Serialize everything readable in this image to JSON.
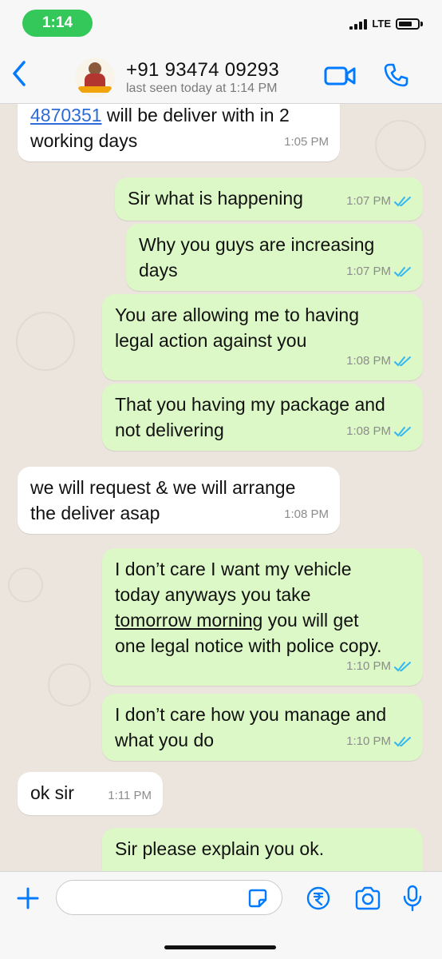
{
  "status_bar": {
    "time": "1:14",
    "network": "LTE"
  },
  "header": {
    "contact_name": "+91 93474 09293",
    "contact_status": "last seen today at 1:14 PM"
  },
  "messages": [
    {
      "direction": "incoming",
      "link": "4870351",
      "text": " will be deliver with in 2\nworking days",
      "time": "1:05 PM"
    },
    {
      "direction": "outgoing",
      "text": "Sir what is happening",
      "time": "1:07 PM"
    },
    {
      "direction": "outgoing",
      "text": "Why you guys are increasing\ndays",
      "time": "1:07 PM"
    },
    {
      "direction": "outgoing",
      "text": "You are allowing me to having\nlegal action against you",
      "time": "1:08 PM"
    },
    {
      "direction": "outgoing",
      "text": "That you having my package and\nnot delivering",
      "time": "1:08 PM"
    },
    {
      "direction": "incoming",
      "text": "we will request & we will arrange\nthe deliver asap",
      "time": "1:08 PM"
    },
    {
      "direction": "outgoing",
      "text_before": "I don’t care I want my vehicle\ntoday anyways you take\n",
      "underlined": "tomorrow morning",
      "text_after": " you will get\none legal notice with police copy.",
      "time": "1:10 PM"
    },
    {
      "direction": "outgoing",
      "text": "I don’t care how you manage and\nwhat you do",
      "time": "1:10 PM"
    },
    {
      "direction": "incoming",
      "text": "ok sir",
      "time": "1:11 PM"
    },
    {
      "direction": "outgoing",
      "text": "Sir please explain you ok.",
      "time": ""
    }
  ],
  "input": {
    "placeholder": "",
    "value": ""
  },
  "colors": {
    "status_pill": "#34c759",
    "incoming_bubble": "#ffffff",
    "outgoing_bubble": "#dcf8c6",
    "accent_blue": "#007aff",
    "read_ticks": "#34b7f1"
  },
  "icons": [
    "back-chevron-icon",
    "video-call-icon",
    "phone-call-icon",
    "plus-icon",
    "sticker-icon",
    "rupee-payment-icon",
    "camera-icon",
    "microphone-icon",
    "read-receipt-icon"
  ]
}
